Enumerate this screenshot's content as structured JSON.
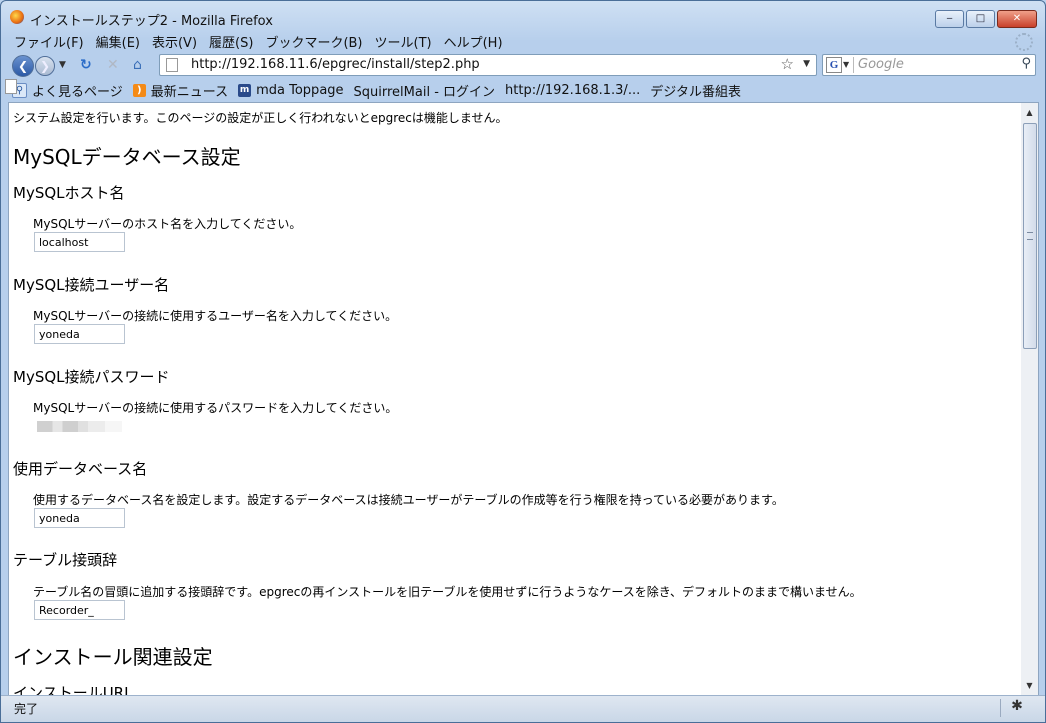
{
  "window": {
    "title": "インストールステップ2 - Mozilla Firefox",
    "minimize": "‒",
    "maximize": "□",
    "close": "✕"
  },
  "menu": [
    "ファイル(F)",
    "編集(E)",
    "表示(V)",
    "履歴(S)",
    "ブックマーク(B)",
    "ツール(T)",
    "ヘルプ(H)"
  ],
  "nav": {
    "url": "http://192.168.11.6/epgrec/install/step2.php",
    "search_placeholder": "Google",
    "search_engine_letter": "G"
  },
  "bookmarks": [
    {
      "label": "よく見るページ",
      "icon": "search-icon"
    },
    {
      "label": "最新ニュース",
      "icon": "rss-icon"
    },
    {
      "label": "mda Toppage",
      "icon": "mda-icon"
    },
    {
      "label": "SquirrelMail - ログイン",
      "icon": "page-icon"
    },
    {
      "label": "http://192.168.1.3/...",
      "icon": "page-icon"
    },
    {
      "label": "デジタル番組表",
      "icon": "page-icon"
    }
  ],
  "content": {
    "intro": "システム設定を行います。このページの設定が正しく行われないとepgrecは機能しません。",
    "section1_title": "MySQLデータベース設定",
    "host": {
      "title": "MySQLホスト名",
      "desc": "MySQLサーバーのホスト名を入力してください。",
      "value": "localhost"
    },
    "user": {
      "title": "MySQL接続ユーザー名",
      "desc": "MySQLサーバーの接続に使用するユーザー名を入力してください。",
      "value": "yoneda"
    },
    "password": {
      "title": "MySQL接続パスワード",
      "desc": "MySQLサーバーの接続に使用するパスワードを入力してください。"
    },
    "dbname": {
      "title": "使用データベース名",
      "desc": "使用するデータベース名を設定します。設定するデータベースは接続ユーザーがテーブルの作成等を行う権限を持っている必要があります。",
      "value": "yoneda"
    },
    "prefix": {
      "title": "テーブル接頭辞",
      "desc": "テーブル名の冒頭に追加する接頭辞です。epgrecの再インストールを旧テーブルを使用せずに行うようなケースを除き、デフォルトのままで構いません。",
      "value": "Recorder_"
    },
    "section2_title": "インストール関連設定",
    "install_url_title": "インストールURL"
  },
  "status": {
    "text": "完了"
  }
}
